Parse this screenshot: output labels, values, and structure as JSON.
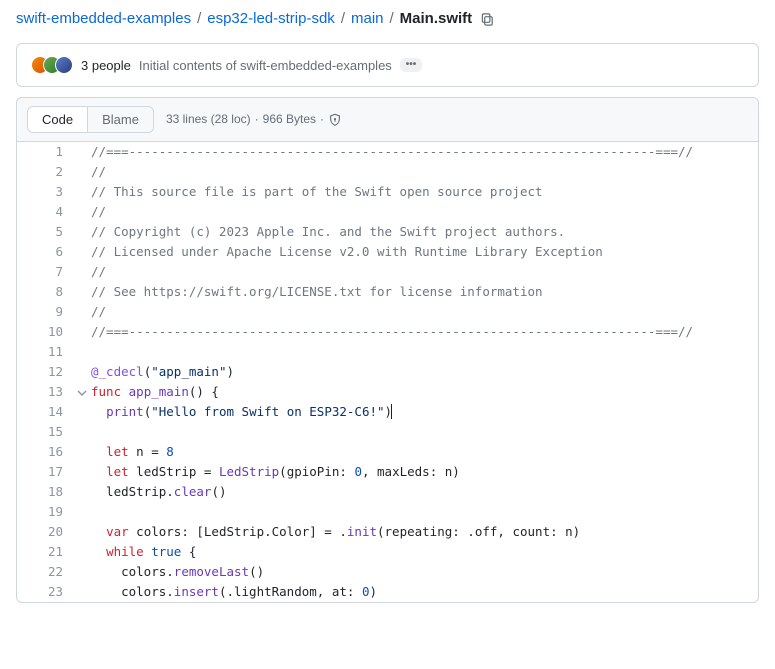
{
  "breadcrumb": {
    "parts": [
      "swift-embedded-examples",
      "esp32-led-strip-sdk",
      "main"
    ],
    "final": "Main.swift"
  },
  "commit": {
    "people_label": "3 people",
    "message": "Initial contents of swift-embedded-examples",
    "more": "•••"
  },
  "fileHeader": {
    "code_label": "Code",
    "blame_label": "Blame",
    "lines_loc": "33 lines (28 loc)",
    "dot": "·",
    "bytes": "966 Bytes"
  },
  "code": {
    "lines": [
      {
        "n": 1,
        "seg": [
          {
            "cls": "tok-comment",
            "t": "//===----------------------------------------------------------------------===//"
          }
        ]
      },
      {
        "n": 2,
        "seg": [
          {
            "cls": "tok-comment",
            "t": "//"
          }
        ]
      },
      {
        "n": 3,
        "seg": [
          {
            "cls": "tok-comment",
            "t": "// This source file is part of the Swift open source project"
          }
        ]
      },
      {
        "n": 4,
        "seg": [
          {
            "cls": "tok-comment",
            "t": "//"
          }
        ]
      },
      {
        "n": 5,
        "seg": [
          {
            "cls": "tok-comment",
            "t": "// Copyright (c) 2023 Apple Inc. and the Swift project authors."
          }
        ]
      },
      {
        "n": 6,
        "seg": [
          {
            "cls": "tok-comment",
            "t": "// Licensed under Apache License v2.0 with Runtime Library Exception"
          }
        ]
      },
      {
        "n": 7,
        "seg": [
          {
            "cls": "tok-comment",
            "t": "//"
          }
        ]
      },
      {
        "n": 8,
        "seg": [
          {
            "cls": "tok-comment",
            "t": "// See https://swift.org/LICENSE.txt for license information"
          }
        ]
      },
      {
        "n": 9,
        "seg": [
          {
            "cls": "tok-comment",
            "t": "//"
          }
        ]
      },
      {
        "n": 10,
        "seg": [
          {
            "cls": "tok-comment",
            "t": "//===----------------------------------------------------------------------===//"
          }
        ]
      },
      {
        "n": 11,
        "seg": [
          {
            "cls": "",
            "t": ""
          }
        ]
      },
      {
        "n": 12,
        "seg": [
          {
            "cls": "tok-attr",
            "t": "@_cdecl"
          },
          {
            "cls": "",
            "t": "("
          },
          {
            "cls": "tok-str",
            "t": "\"app_main\""
          },
          {
            "cls": "",
            "t": ")"
          }
        ]
      },
      {
        "n": 13,
        "chev": true,
        "seg": [
          {
            "cls": "tok-kw",
            "t": "func"
          },
          {
            "cls": "",
            "t": " "
          },
          {
            "cls": "tok-fn",
            "t": "app_main"
          },
          {
            "cls": "",
            "t": "() {"
          }
        ]
      },
      {
        "n": 14,
        "caret": true,
        "seg": [
          {
            "cls": "",
            "t": "  "
          },
          {
            "cls": "tok-fn",
            "t": "print"
          },
          {
            "cls": "",
            "t": "("
          },
          {
            "cls": "tok-str",
            "t": "\"Hello from Swift on ESP32-C6!\""
          },
          {
            "cls": "",
            "t": ")"
          }
        ]
      },
      {
        "n": 15,
        "seg": [
          {
            "cls": "",
            "t": ""
          }
        ]
      },
      {
        "n": 16,
        "seg": [
          {
            "cls": "",
            "t": "  "
          },
          {
            "cls": "tok-kw",
            "t": "let"
          },
          {
            "cls": "",
            "t": " n = "
          },
          {
            "cls": "tok-num",
            "t": "8"
          }
        ]
      },
      {
        "n": 17,
        "seg": [
          {
            "cls": "",
            "t": "  "
          },
          {
            "cls": "tok-kw",
            "t": "let"
          },
          {
            "cls": "",
            "t": " ledStrip = "
          },
          {
            "cls": "tok-fn",
            "t": "LedStrip"
          },
          {
            "cls": "",
            "t": "(gpioPin: "
          },
          {
            "cls": "tok-num",
            "t": "0"
          },
          {
            "cls": "",
            "t": ", maxLeds: n)"
          }
        ]
      },
      {
        "n": 18,
        "seg": [
          {
            "cls": "",
            "t": "  ledStrip."
          },
          {
            "cls": "tok-fn",
            "t": "clear"
          },
          {
            "cls": "",
            "t": "()"
          }
        ]
      },
      {
        "n": 19,
        "seg": [
          {
            "cls": "",
            "t": ""
          }
        ]
      },
      {
        "n": 20,
        "seg": [
          {
            "cls": "",
            "t": "  "
          },
          {
            "cls": "tok-kw",
            "t": "var"
          },
          {
            "cls": "",
            "t": " colors: [LedStrip.Color] = ."
          },
          {
            "cls": "tok-fn",
            "t": "init"
          },
          {
            "cls": "",
            "t": "(repeating: .off, count: n)"
          }
        ]
      },
      {
        "n": 21,
        "seg": [
          {
            "cls": "",
            "t": "  "
          },
          {
            "cls": "tok-kw",
            "t": "while"
          },
          {
            "cls": "",
            "t": " "
          },
          {
            "cls": "tok-num",
            "t": "true"
          },
          {
            "cls": "",
            "t": " {"
          }
        ]
      },
      {
        "n": 22,
        "seg": [
          {
            "cls": "",
            "t": "    colors."
          },
          {
            "cls": "tok-fn",
            "t": "removeLast"
          },
          {
            "cls": "",
            "t": "()"
          }
        ]
      },
      {
        "n": 23,
        "seg": [
          {
            "cls": "",
            "t": "    colors."
          },
          {
            "cls": "tok-fn",
            "t": "insert"
          },
          {
            "cls": "",
            "t": "(.lightRandom, at: "
          },
          {
            "cls": "tok-num",
            "t": "0"
          },
          {
            "cls": "",
            "t": ")"
          }
        ]
      }
    ]
  }
}
